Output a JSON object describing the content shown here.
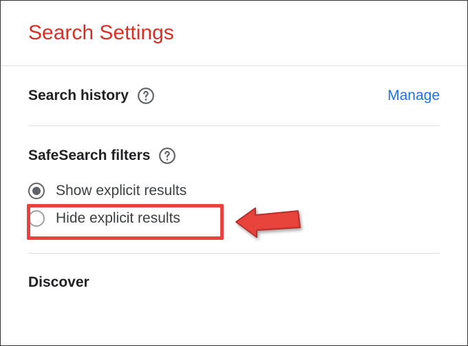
{
  "page": {
    "title": "Search Settings"
  },
  "sections": {
    "searchHistory": {
      "label": "Search history",
      "manageLink": "Manage"
    },
    "safeSearch": {
      "label": "SafeSearch filters",
      "options": [
        {
          "label": "Show explicit results",
          "selected": true
        },
        {
          "label": "Hide explicit results",
          "selected": false
        }
      ]
    },
    "discover": {
      "label": "Discover"
    }
  },
  "annotations": {
    "highlightColor": "#e8433e"
  }
}
